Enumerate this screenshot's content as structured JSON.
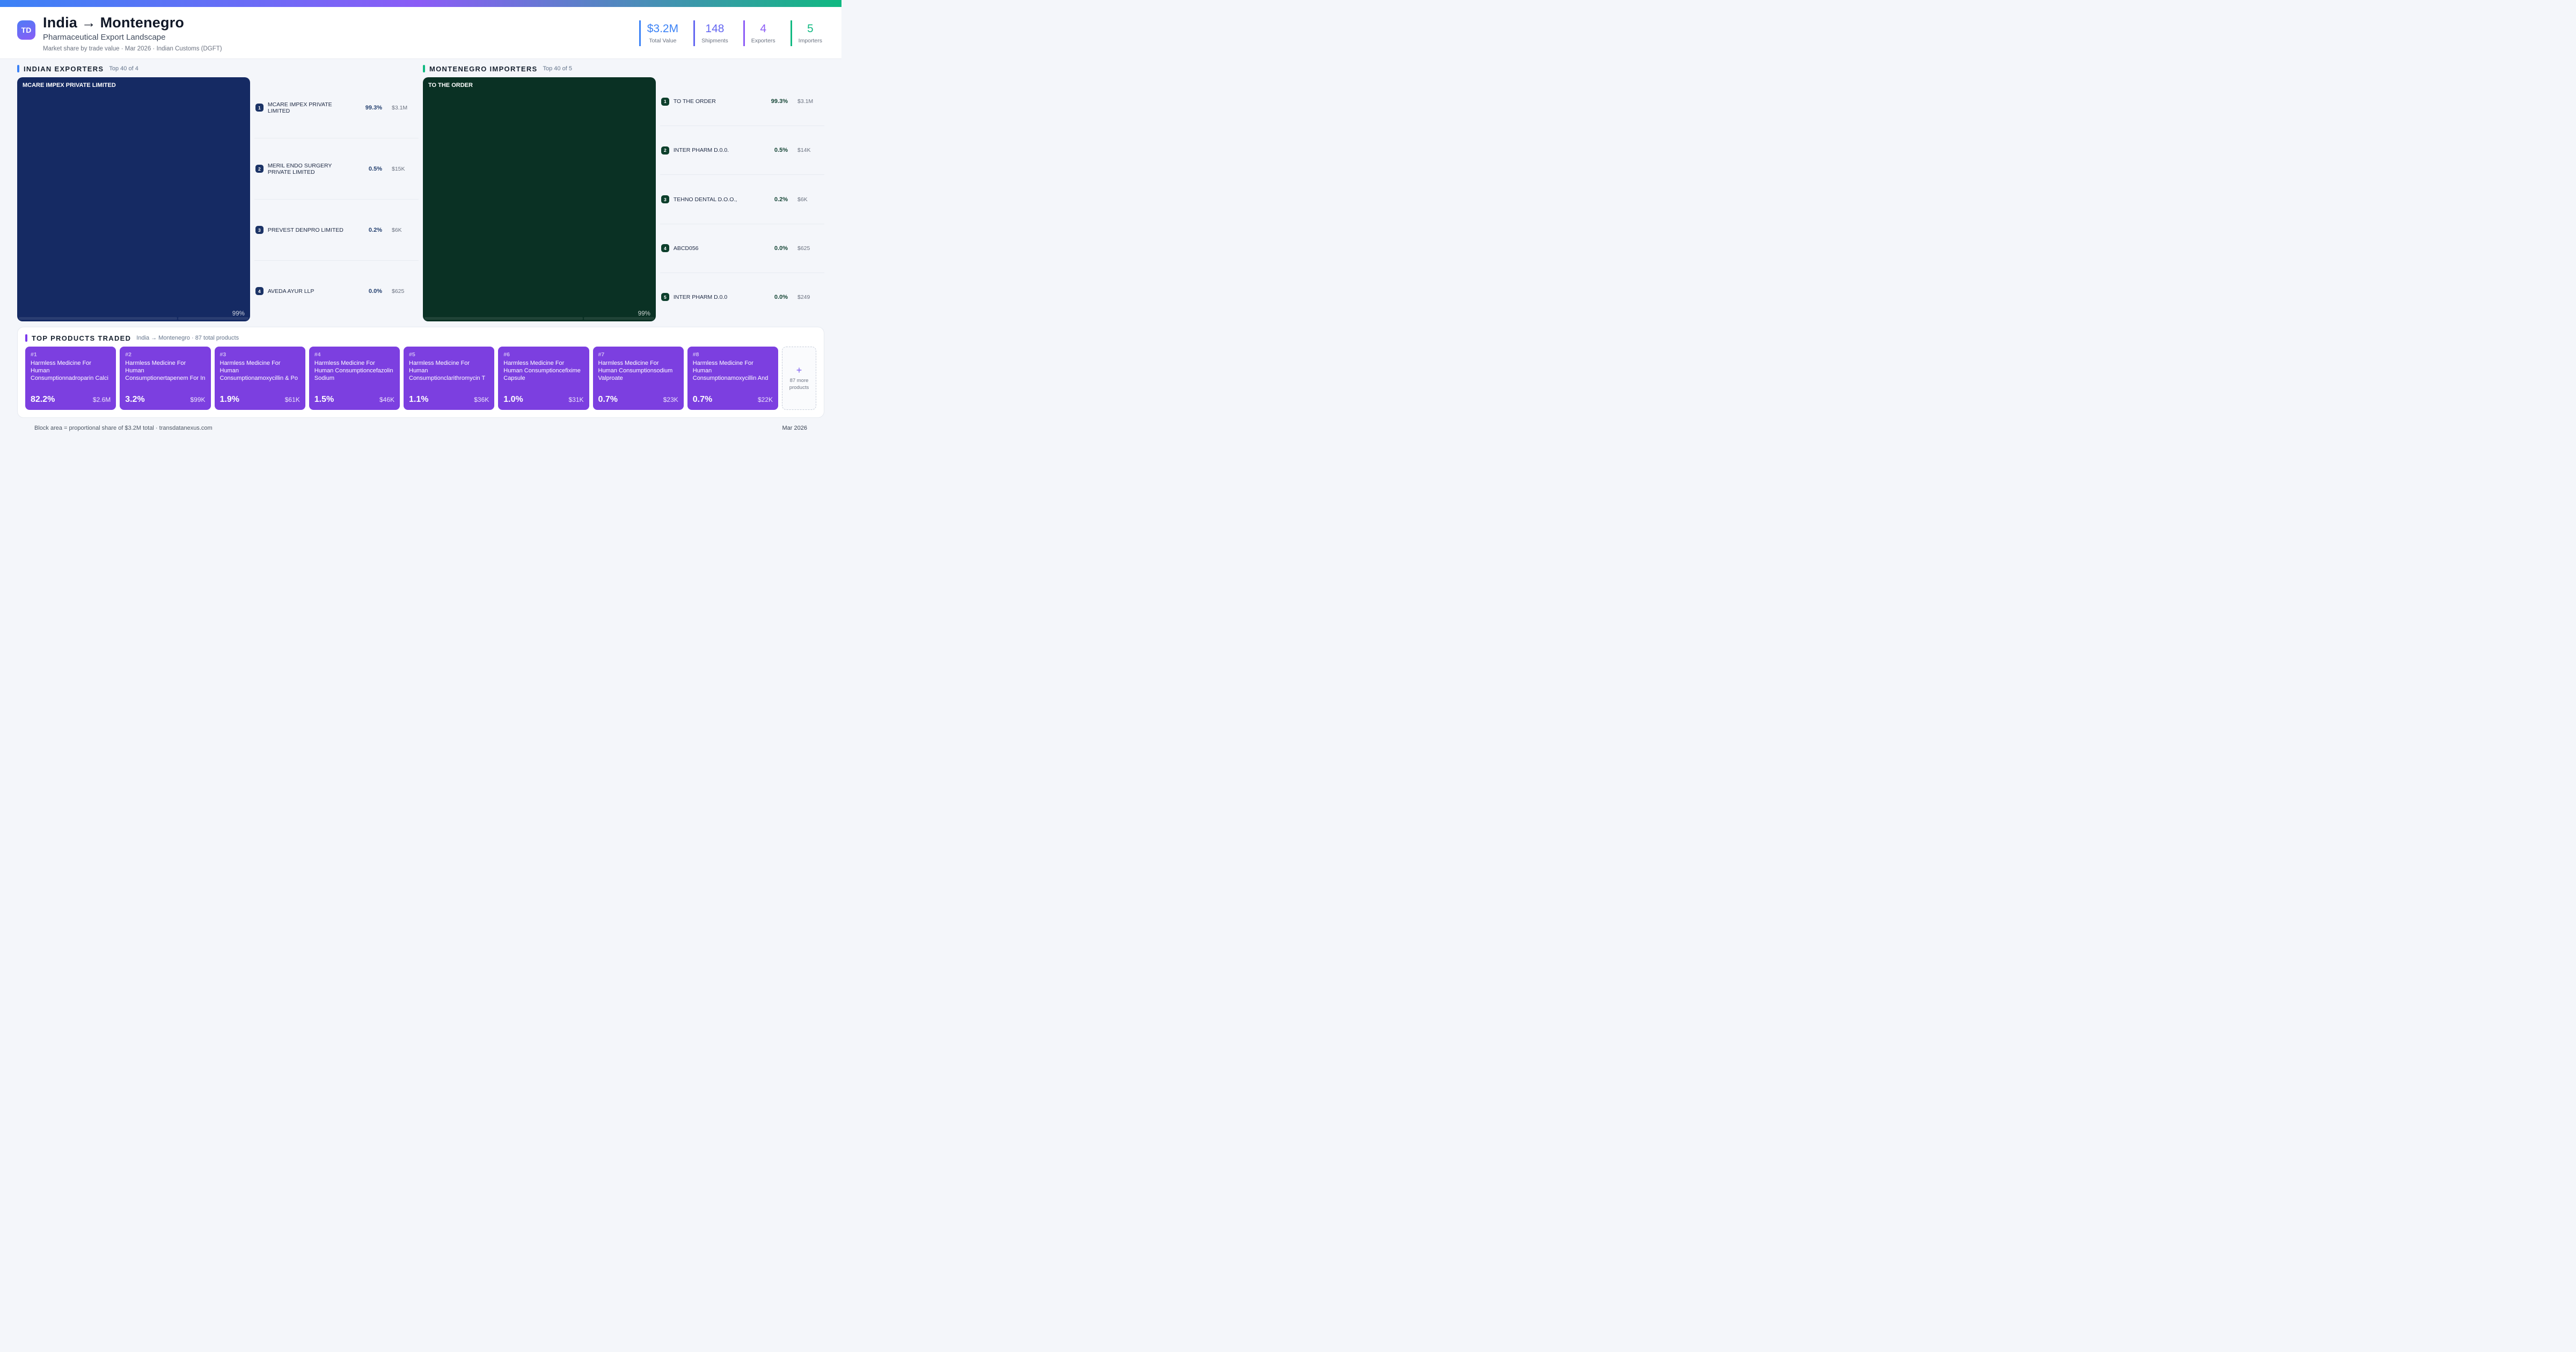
{
  "header": {
    "logo_initials": "TD",
    "title": "India → Montenegro",
    "subtitle": "Pharmaceutical Export Landscape",
    "meta": "Market share by trade value · Mar 2026 · Indian Customs (DGFT)"
  },
  "stats": [
    {
      "value": "$3.2M",
      "label": "Total Value",
      "color": "#3b82f6"
    },
    {
      "value": "148",
      "label": "Shipments",
      "color": "#6366f1"
    },
    {
      "value": "4",
      "label": "Exporters",
      "color": "#8b5cf6"
    },
    {
      "value": "5",
      "label": "Importers",
      "color": "#10b981"
    }
  ],
  "exporters": {
    "title": "INDIAN EXPORTERS",
    "subtitle": "Top 40 of 4",
    "accent": "#3b82f6",
    "treemap": {
      "label": "MCARE IMPEX PRIVATE LIMITED",
      "share": "99%",
      "color": "#152a63"
    },
    "items": [
      {
        "rank": "1",
        "name": "MCARE IMPEX PRIVATE LIMITED",
        "share": "99.3%",
        "value": "$3.1M"
      },
      {
        "rank": "2",
        "name": "MERIL ENDO SURGERY PRIVATE LIMITED",
        "share": "0.5%",
        "value": "$15K"
      },
      {
        "rank": "3",
        "name": "PREVEST DENPRO LIMITED",
        "share": "0.2%",
        "value": "$6K"
      },
      {
        "rank": "4",
        "name": "AVEDA AYUR LLP",
        "share": "0.0%",
        "value": "$625"
      }
    ]
  },
  "importers": {
    "title": "MONTENEGRO IMPORTERS",
    "subtitle": "Top 40 of 5",
    "accent": "#10b981",
    "treemap": {
      "label": "TO THE ORDER",
      "share": "99%",
      "color": "#0a3124"
    },
    "items": [
      {
        "rank": "1",
        "name": "TO THE ORDER",
        "share": "99.3%",
        "value": "$3.1M"
      },
      {
        "rank": "2",
        "name": "INTER PHARM D.0.0.",
        "share": "0.5%",
        "value": "$14K"
      },
      {
        "rank": "3",
        "name": "TEHNO DENTAL D.O.O.,",
        "share": "0.2%",
        "value": "$6K"
      },
      {
        "rank": "4",
        "name": "ABCD056",
        "share": "0.0%",
        "value": "$625"
      },
      {
        "rank": "5",
        "name": "INTER PHARM D.0.0",
        "share": "0.0%",
        "value": "$249"
      }
    ]
  },
  "products": {
    "title": "TOP PRODUCTS TRADED",
    "subtitle": "India → Montenegro · 87 total products",
    "accent": "#7c3aed",
    "card_color": "#7c3fe0",
    "cards": [
      {
        "rank": "#1",
        "name": "Harmless Medicine For Human Consumptionnadroparin Calci",
        "share": "82.2%",
        "value": "$2.6M"
      },
      {
        "rank": "#2",
        "name": "Harmless Medicine For Human Consumptionertapenem For In",
        "share": "3.2%",
        "value": "$99K"
      },
      {
        "rank": "#3",
        "name": "Harmless Medicine For Human Consumptionamoxycillin & Po",
        "share": "1.9%",
        "value": "$61K"
      },
      {
        "rank": "#4",
        "name": "Harmless Medicine For Human Consumptioncefazolin Sodium",
        "share": "1.5%",
        "value": "$46K"
      },
      {
        "rank": "#5",
        "name": "Harmless Medicine For Human Consumptionclarithromycin T",
        "share": "1.1%",
        "value": "$36K"
      },
      {
        "rank": "#6",
        "name": "Harmless Medicine For Human Consumptioncefixime Capsule",
        "share": "1.0%",
        "value": "$31K"
      },
      {
        "rank": "#7",
        "name": "Harmless Medicine For Human Consumptionsodium Valproate",
        "share": "0.7%",
        "value": "$23K"
      },
      {
        "rank": "#8",
        "name": "Harmless Medicine For Human Consumptionamoxycillin And",
        "share": "0.7%",
        "value": "$22K"
      }
    ],
    "more": {
      "plus": "+",
      "label": "87 more products"
    }
  },
  "footer": {
    "left": "Block area = proportional share of $3.2M total · transdatanexus.com",
    "right": "Mar 2026"
  },
  "chart_data": [
    {
      "type": "treemap",
      "title": "INDIAN EXPORTERS (Top 40 of 4)",
      "unit": "% share of $3.2M total trade value",
      "items": [
        {
          "label": "MCARE IMPEX PRIVATE LIMITED",
          "share_pct": 99.3,
          "value": "$3.1M"
        },
        {
          "label": "MERIL ENDO SURGERY PRIVATE LIMITED",
          "share_pct": 0.5,
          "value": "$15K"
        },
        {
          "label": "PREVEST DENPRO LIMITED",
          "share_pct": 0.2,
          "value": "$6K"
        },
        {
          "label": "AVEDA AYUR LLP",
          "share_pct": 0.0,
          "value": "$625"
        }
      ]
    },
    {
      "type": "treemap",
      "title": "MONTENEGRO IMPORTERS (Top 40 of 5)",
      "unit": "% share of $3.2M total trade value",
      "items": [
        {
          "label": "TO THE ORDER",
          "share_pct": 99.3,
          "value": "$3.1M"
        },
        {
          "label": "INTER PHARM D.0.0.",
          "share_pct": 0.5,
          "value": "$14K"
        },
        {
          "label": "TEHNO DENTAL D.O.O.,",
          "share_pct": 0.2,
          "value": "$6K"
        },
        {
          "label": "ABCD056",
          "share_pct": 0.0,
          "value": "$625"
        },
        {
          "label": "INTER PHARM D.0.0",
          "share_pct": 0.0,
          "value": "$249"
        }
      ]
    },
    {
      "type": "table",
      "title": "TOP PRODUCTS TRADED (87 total products)",
      "columns": [
        "rank",
        "product",
        "share_pct",
        "value"
      ],
      "rows": [
        [
          1,
          "Harmless Medicine For Human Consumptionnadroparin Calci",
          82.2,
          "$2.6M"
        ],
        [
          2,
          "Harmless Medicine For Human Consumptionertapenem For In",
          3.2,
          "$99K"
        ],
        [
          3,
          "Harmless Medicine For Human Consumptionamoxycillin & Po",
          1.9,
          "$61K"
        ],
        [
          4,
          "Harmless Medicine For Human Consumptioncefazolin Sodium",
          1.5,
          "$46K"
        ],
        [
          5,
          "Harmless Medicine For Human Consumptionclarithromycin T",
          1.1,
          "$36K"
        ],
        [
          6,
          "Harmless Medicine For Human Consumptioncefixime Capsule",
          1.0,
          "$31K"
        ],
        [
          7,
          "Harmless Medicine For Human Consumptionsodium Valproate",
          0.7,
          "$23K"
        ],
        [
          8,
          "Harmless Medicine For Human Consumptionamoxycillin And",
          0.7,
          "$22K"
        ]
      ]
    }
  ]
}
